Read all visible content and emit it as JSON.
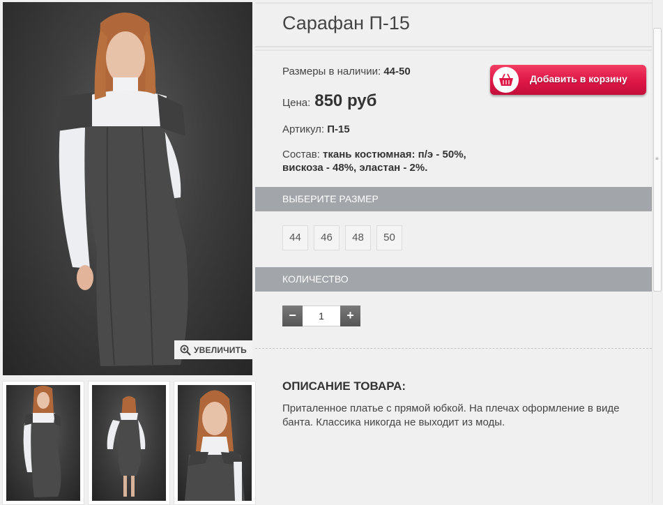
{
  "product": {
    "title": "Сарафан П-15",
    "sizes_label": "Размеры в наличии:",
    "sizes_value": "44-50",
    "price_label": "Цена:",
    "price_value": "850 руб",
    "sku_label": "Артикул:",
    "sku_value": "П-15",
    "composition_label": "Состав:",
    "composition_value": "ткань костюмная: п/э - 50%, вискоза - 48%, эластан - 2%."
  },
  "cart": {
    "label": "Добавить в корзину",
    "icon": "basket-icon"
  },
  "gallery": {
    "zoom_label": "УВЕЛИЧИТЬ",
    "zoom_icon": "magnifier-plus-icon"
  },
  "size_section": {
    "title": "ВЫБЕРИТЕ РАЗМЕР",
    "options": [
      "44",
      "46",
      "48",
      "50"
    ]
  },
  "quantity_section": {
    "title": "КОЛИЧЕСТВО",
    "value": "1",
    "minus": "−",
    "plus": "+"
  },
  "description": {
    "title": "ОПИСАНИЕ ТОВАРА:",
    "text": "Приталенное платье с прямой юбкой. На плечах оформление в виде банта. Классика никогда не выходит из моды."
  },
  "colors": {
    "accent": "#dd1646",
    "section_bar": "#a2a5a9",
    "background": "#f0f0f0"
  }
}
